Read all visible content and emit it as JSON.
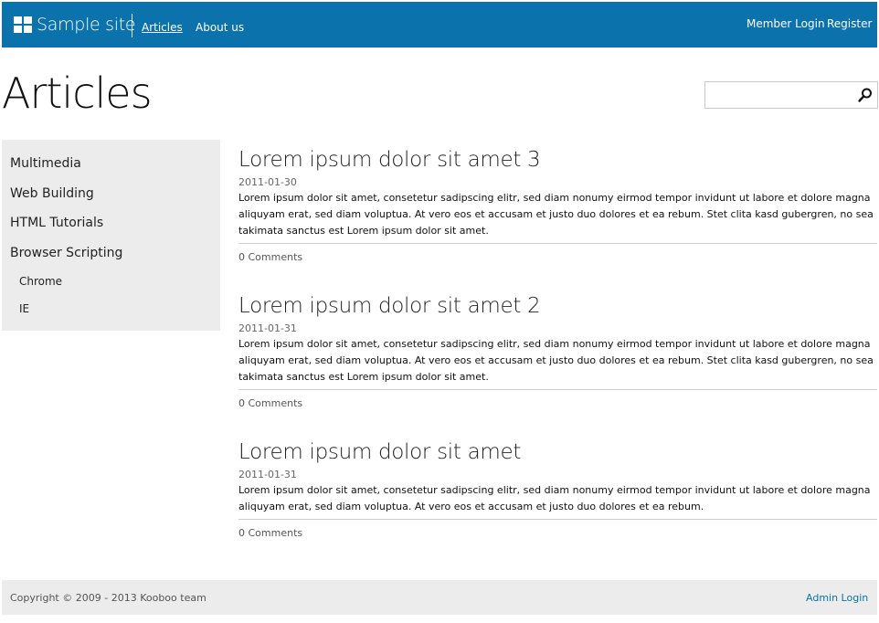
{
  "header": {
    "site_title": "Sample site",
    "nav": [
      {
        "label": "Articles",
        "active": true
      },
      {
        "label": "About us",
        "active": false
      }
    ],
    "member_login": "Member Login",
    "register": "Register",
    "bar_color": "#0b72ab"
  },
  "page": {
    "title": "Articles"
  },
  "search": {
    "placeholder": "",
    "value": "",
    "icon": "search-icon"
  },
  "sidebar": {
    "items": [
      {
        "label": "Multimedia"
      },
      {
        "label": "Web Building"
      },
      {
        "label": "HTML Tutorials"
      },
      {
        "label": "Browser Scripting"
      }
    ],
    "subitems": [
      {
        "label": "Chrome"
      },
      {
        "label": "IE"
      }
    ]
  },
  "articles": [
    {
      "title": "Lorem ipsum dolor sit amet 3",
      "date": "2011-01-30",
      "body": "Lorem ipsum dolor sit amet, consetetur sadipscing elitr, sed diam nonumy eirmod tempor invidunt ut labore et dolore magna aliquyam erat, sed diam voluptua. At vero eos et accusam et justo duo dolores et ea rebum. Stet clita kasd gubergren, no sea takimata sanctus est Lorem ipsum dolor sit amet.",
      "comments": "0 Comments"
    },
    {
      "title": "Lorem ipsum dolor sit amet 2",
      "date": "2011-01-31",
      "body": "Lorem ipsum dolor sit amet, consetetur sadipscing elitr, sed diam nonumy eirmod tempor invidunt ut labore et dolore magna aliquyam erat, sed diam voluptua. At vero eos et accusam et justo duo dolores et ea rebum. Stet clita kasd gubergren, no sea takimata sanctus est Lorem ipsum dolor sit amet.",
      "comments": "0 Comments"
    },
    {
      "title": "Lorem ipsum dolor sit amet",
      "date": "2011-01-31",
      "body": "Lorem ipsum dolor sit amet, consetetur sadipscing elitr, sed diam nonumy eirmod tempor invidunt ut labore et dolore magna aliquyam erat, sed diam voluptua. At vero eos et accusam et justo duo dolores et ea rebum.",
      "comments": "0 Comments"
    }
  ],
  "footer": {
    "copyright": "Copyright © 2009 - 2013 Kooboo team",
    "admin_login": "Admin Login",
    "link_color": "#0b72ab"
  }
}
